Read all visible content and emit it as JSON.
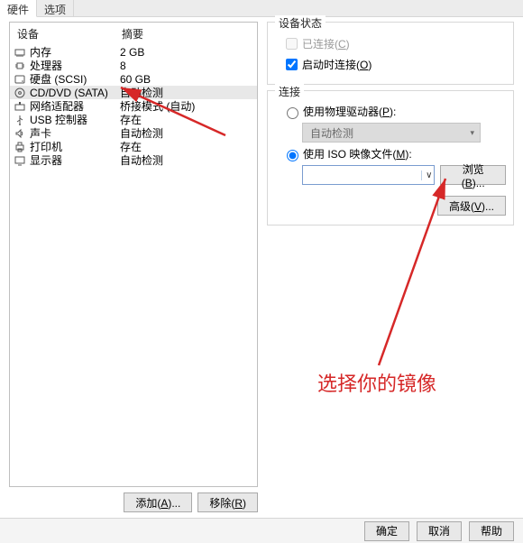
{
  "tabs": {
    "hardware": "硬件",
    "options": "选项"
  },
  "left": {
    "hdr_device": "设备",
    "hdr_summary": "摘要",
    "rows": [
      {
        "icon": "memory-icon",
        "name": "内存",
        "summary": "2 GB"
      },
      {
        "icon": "cpu-icon",
        "name": "处理器",
        "summary": "8"
      },
      {
        "icon": "hdd-icon",
        "name": "硬盘 (SCSI)",
        "summary": "60 GB"
      },
      {
        "icon": "disc-icon",
        "name": "CD/DVD (SATA)",
        "summary": "自动检测"
      },
      {
        "icon": "nic-icon",
        "name": "网络适配器",
        "summary": "桥接模式 (自动)"
      },
      {
        "icon": "usb-icon",
        "name": "USB 控制器",
        "summary": "存在"
      },
      {
        "icon": "sound-icon",
        "name": "声卡",
        "summary": "自动检测"
      },
      {
        "icon": "printer-icon",
        "name": "打印机",
        "summary": "存在"
      },
      {
        "icon": "display-icon",
        "name": "显示器",
        "summary": "自动检测"
      }
    ],
    "btn_add": "添加(A)...",
    "btn_remove": "移除(R)"
  },
  "right": {
    "grp_state": "设备状态",
    "cb_connected": "已连接",
    "cb_connected_hot": "C",
    "cb_poweron": "启动时连接",
    "cb_poweron_hot": "O",
    "grp_conn": "连接",
    "rb_phys": "使用物理驱动器",
    "rb_phys_hot": "P",
    "drv_auto": "自动检测",
    "rb_iso": "使用 ISO 映像文件",
    "rb_iso_hot": "M",
    "iso_value": "",
    "btn_browse": "浏览",
    "btn_browse_hot": "B",
    "btn_adv": "高级",
    "btn_adv_hot": "V"
  },
  "bottom": {
    "ok": "确定",
    "cancel": "取消",
    "help": "帮助"
  },
  "annotation": {
    "text": "选择你的镜像",
    "color": "#d62828"
  }
}
